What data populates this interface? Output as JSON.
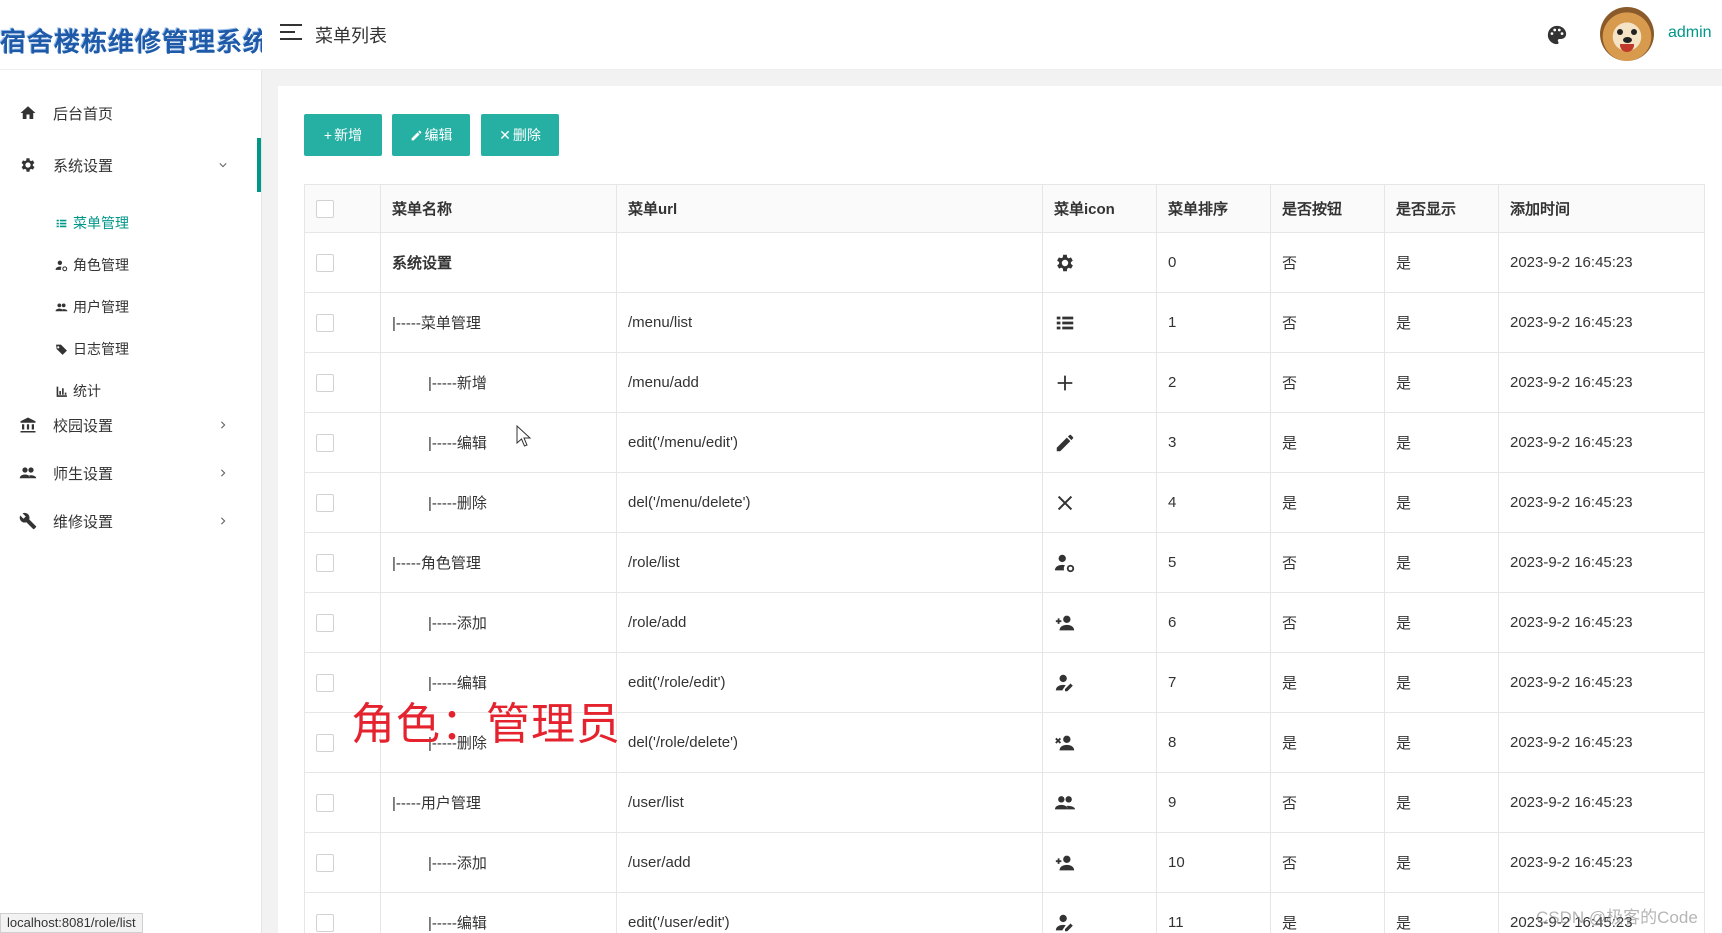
{
  "app": {
    "logo_text": "宿舍楼栋维修管理系统",
    "page_title": "菜单列表",
    "user_name": "admin"
  },
  "sidebar": {
    "items": [
      {
        "label": "后台首页",
        "icon": "home-icon"
      },
      {
        "label": "系统设置",
        "icon": "gear-icon",
        "expanded": true
      },
      {
        "label": "校园设置",
        "icon": "bank-icon"
      },
      {
        "label": "师生设置",
        "icon": "group-icon"
      },
      {
        "label": "维修设置",
        "icon": "wrench-icon"
      }
    ],
    "sub_items": [
      {
        "label": "菜单管理",
        "icon": "list-icon",
        "active": true
      },
      {
        "label": "角色管理",
        "icon": "user-gear-icon"
      },
      {
        "label": "用户管理",
        "icon": "users-icon"
      },
      {
        "label": "日志管理",
        "icon": "tag-icon"
      },
      {
        "label": "统计",
        "icon": "bar-chart-icon"
      }
    ]
  },
  "toolbar": {
    "add_label": "新增",
    "edit_label": "编辑",
    "delete_label": "删除"
  },
  "table": {
    "headers": [
      "菜单名称",
      "菜单url",
      "菜单icon",
      "菜单排序",
      "是否按钮",
      "是否显示",
      "添加时间"
    ],
    "rows": [
      {
        "name": "系统设置",
        "url": "",
        "icon": "gear-icon",
        "order": "0",
        "is_button": "否",
        "is_show": "是",
        "time": "2023-9-2 16:45:23"
      },
      {
        "name": "|-----菜单管理",
        "url": "/menu/list",
        "icon": "list-icon",
        "order": "1",
        "is_button": "否",
        "is_show": "是",
        "time": "2023-9-2 16:45:23"
      },
      {
        "name": "|-----新增",
        "url": "/menu/add",
        "icon": "plus-icon",
        "order": "2",
        "is_button": "否",
        "is_show": "是",
        "time": "2023-9-2 16:45:23"
      },
      {
        "name": "|-----编辑",
        "url": "edit('/menu/edit')",
        "icon": "pencil-icon",
        "order": "3",
        "is_button": "是",
        "is_show": "是",
        "time": "2023-9-2 16:45:23"
      },
      {
        "name": "|-----删除",
        "url": "del('/menu/delete')",
        "icon": "close-icon",
        "order": "4",
        "is_button": "是",
        "is_show": "是",
        "time": "2023-9-2 16:45:23"
      },
      {
        "name": "|-----角色管理",
        "url": "/role/list",
        "icon": "user-gear-icon",
        "order": "5",
        "is_button": "否",
        "is_show": "是",
        "time": "2023-9-2 16:45:23"
      },
      {
        "name": "|-----添加",
        "url": "/role/add",
        "icon": "user-add-icon",
        "order": "6",
        "is_button": "否",
        "is_show": "是",
        "time": "2023-9-2 16:45:23"
      },
      {
        "name": "|-----编辑",
        "url": "edit('/role/edit')",
        "icon": "user-edit-icon",
        "order": "7",
        "is_button": "是",
        "is_show": "是",
        "time": "2023-9-2 16:45:23"
      },
      {
        "name": "|-----删除",
        "url": "del('/role/delete')",
        "icon": "user-remove-icon",
        "order": "8",
        "is_button": "是",
        "is_show": "是",
        "time": "2023-9-2 16:45:23"
      },
      {
        "name": "|-----用户管理",
        "url": "/user/list",
        "icon": "users-icon",
        "order": "9",
        "is_button": "否",
        "is_show": "是",
        "time": "2023-9-2 16:45:23"
      },
      {
        "name": "|-----添加",
        "url": "/user/add",
        "icon": "user-add-icon",
        "order": "10",
        "is_button": "否",
        "is_show": "是",
        "time": "2023-9-2 16:45:23"
      },
      {
        "name": "|-----编辑",
        "url": "edit('/user/edit')",
        "icon": "user-edit-icon",
        "order": "11",
        "is_button": "是",
        "is_show": "是",
        "time": "2023-9-2 16:45:23"
      }
    ]
  },
  "overlay": {
    "text": "角色：管理员"
  },
  "status_bar": {
    "url": "localhost:8081/role/list"
  },
  "watermark": {
    "text": "CSDN @极客的Code"
  },
  "colors": {
    "accent": "#009688",
    "button": "#26b0a3",
    "no": "#1e9fff",
    "overlay": "#e5232e"
  }
}
